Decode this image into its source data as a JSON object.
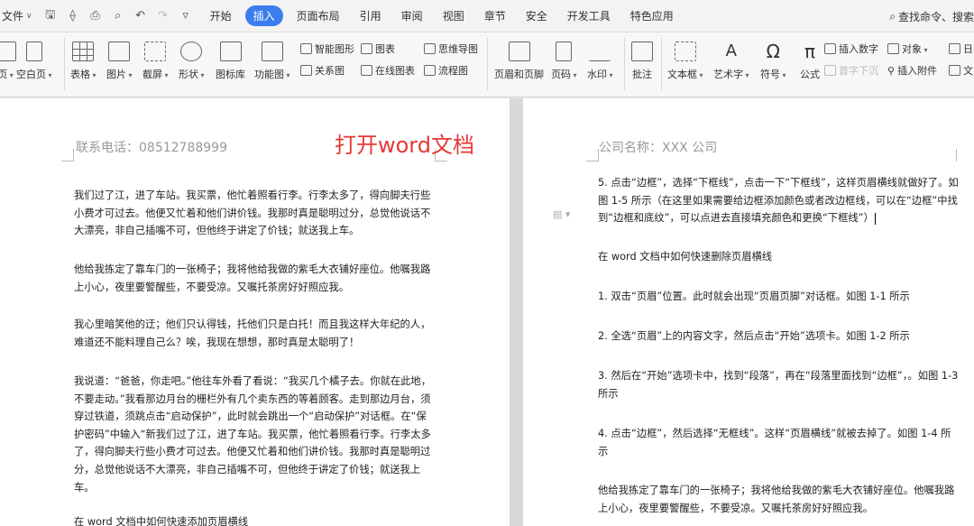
{
  "menu": {
    "file": "文件",
    "tabs": [
      "开始",
      "插入",
      "页面布局",
      "引用",
      "审阅",
      "视图",
      "章节",
      "安全",
      "开发工具",
      "特色应用"
    ],
    "active_tab": "插入",
    "search": "查找命令、搜索"
  },
  "ribbon": {
    "page_partial": "页",
    "blank_page": "空白页",
    "table": "表格",
    "picture": "图片",
    "screenshot": "截屏",
    "shape": "形状",
    "icon_lib": "图标库",
    "func_chart": "功能图",
    "smart_shape": "智能图形",
    "chart": "图表",
    "mind_map": "思维导图",
    "relation": "关系图",
    "online_chart": "在线图表",
    "flowchart": "流程图",
    "header_footer": "页眉和页脚",
    "page_num": "页码",
    "watermark": "水印",
    "comment": "批注",
    "textbox": "文本框",
    "wordart": "艺术字",
    "symbol": "符号",
    "formula": "公式",
    "insert_number": "插入数字",
    "object": "对象",
    "date_partial": "日",
    "dropcap": "首字下沉",
    "attachment": "插入附件",
    "text_partial": "文"
  },
  "left_page": {
    "header": "联系电话：08512788999",
    "paragraphs": [
      "我们过了江，进了车站。我买票，他忙着照看行李。行李太多了，得向脚夫行些小费才可过去。他便又忙着和他们讲价钱。我那时真是聪明过分，总觉他说话不大漂亮，非自己插嘴不可，但他终于讲定了价钱；就送我上车。",
      "他给我拣定了靠车门的一张椅子；我将他给我做的紫毛大衣铺好座位。他嘱我路上小心，夜里要警醒些，不要受凉。又嘱托茶房好好照应我。",
      "我心里暗笑他的迂；他们只认得钱，托他们只是白托！而且我这样大年纪的人，难道还不能料理自己么？唉，我现在想想，那时真是太聪明了！",
      "我说道：“爸爸，你走吧。”他往车外看了看说：“我买几个橘子去。你就在此地，不要走动。”我看那边月台的栅栏外有几个卖东西的等着顾客。走到那边月台，须穿过铁道，须跳点击“启动保护”，此时就会跳出一个“启动保护”对话框。在“保护密码”中输入“新我们过了江，进了车站。我买票，他忙着照看行李。行李太多了，得向脚夫行些小费才可过去。他便又忙着和他们讲价钱。我那时真是聪明过分，总觉他说话不大漂亮，非自己插嘴不可，但他终于讲定了价钱；就送我上车。",
      "在 word 文档中如何快速添加页眉横线"
    ]
  },
  "overlay_text": "打开word文档",
  "right_page": {
    "header": "公司名称：XXX 公司",
    "paragraphs": [
      "5. 点击“边框”，选择“下框线”，点击一下“下框线”，这样页眉横线就做好了。如图 1-5 所示（在这里如果需要给边框添加颜色或者改边框线，可以在“边框”中找到“边框和底纹”，可以点进去直接填充颜色和更换“下框线”）",
      "在 word 文档中如何快速删除页眉横线",
      "1. 双击“页眉”位置。此时就会出现“页眉页脚”对话框。如图 1-1 所示",
      "2. 全选“页眉”上的内容文字，然后点击“开始”选项卡。如图 1-2 所示",
      "3. 然后在“开始”选项卡中，找到“段落”，再在“段落里面找到“边框”，。如图 1-3 所示",
      "4. 点击“边框”，然后选择“无框线”。这样“页眉横线”就被去掉了。如图 1-4 所示",
      "他给我拣定了靠车门的一张椅子；我将他给我做的紫毛大衣铺好座位。他嘱我路上小心，夜里要警醒些，不要受凉。又嘱托茶房好好照应我。"
    ]
  }
}
